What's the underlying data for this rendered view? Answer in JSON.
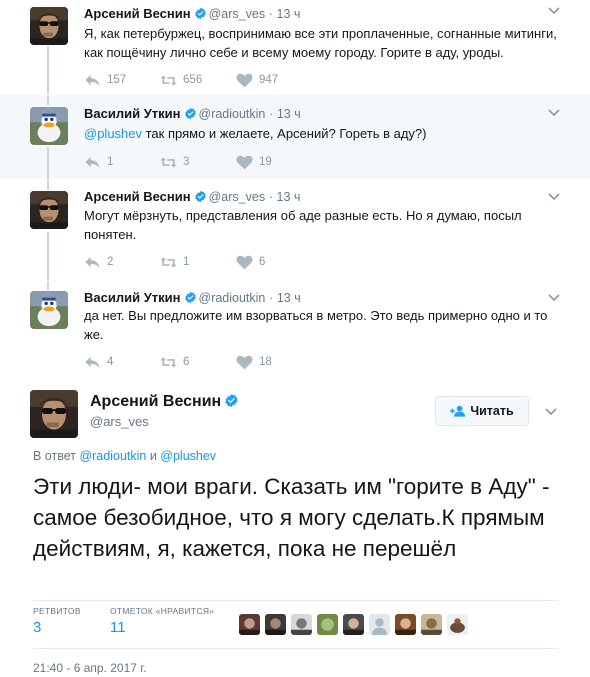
{
  "thread": [
    {
      "name": "Арсений Веснин",
      "handle": "@ars_ves",
      "dot": "·",
      "time": "13 ч",
      "text": "Я, как петербуржец, воспринимаю все эти проплаченные, согнанные митинги, как пощёчину лично себе и всему моему городу. Горите в аду, уроды.",
      "replies": "157",
      "retweets": "656",
      "likes": "947"
    },
    {
      "name": "Василий Уткин",
      "handle": "@radioutkin",
      "dot": "·",
      "time": "13 ч",
      "mention": "@plushev",
      "text": " так прямо и желаете, Арсений? Гореть в аду?)",
      "replies": "1",
      "retweets": "3",
      "likes": "19"
    },
    {
      "name": "Арсений Веснин",
      "handle": "@ars_ves",
      "dot": "·",
      "time": "13 ч",
      "text": "Могут мёрзнуть, представления об аде разные есть. Но я думаю, посыл понятен.",
      "replies": "2",
      "retweets": "1",
      "likes": "6"
    },
    {
      "name": "Василий Уткин",
      "handle": "@radioutkin",
      "dot": "·",
      "time": "13 ч",
      "text": "да нет. Вы предложите им взорваться в метро. Это ведь примерно одно и то же.",
      "replies": "4",
      "retweets": "6",
      "likes": "18"
    }
  ],
  "main": {
    "name": "Арсений Веснин",
    "handle": "@ars_ves",
    "follow_label": "Читать",
    "reply_prefix": "В ответ ",
    "reply_user1": "@radioutkin",
    "reply_and": " и ",
    "reply_user2": "@plushev",
    "text": "Эти люди- мои враги. Сказать им \"горите в Аду\" - самое безобидное, что я могу сделать.К прямым действиям, я, кажется, пока не перешёл",
    "retweets_label": "РЕТВИТОВ",
    "retweets": "3",
    "likes_label": "ОТМЕТОК «НРАВИТСЯ»",
    "likes": "11",
    "timestamp": "21:40 - 6 апр. 2017 г."
  },
  "colors": {
    "link": "#1b95e0",
    "verified": "#1da1f2",
    "muted": "#657786",
    "highlight_bg": "#f5f8fa"
  },
  "icons": [
    "reply-icon",
    "retweet-icon",
    "heart-icon",
    "verified-badge-icon",
    "chevron-down-icon",
    "follow-user-icon"
  ]
}
